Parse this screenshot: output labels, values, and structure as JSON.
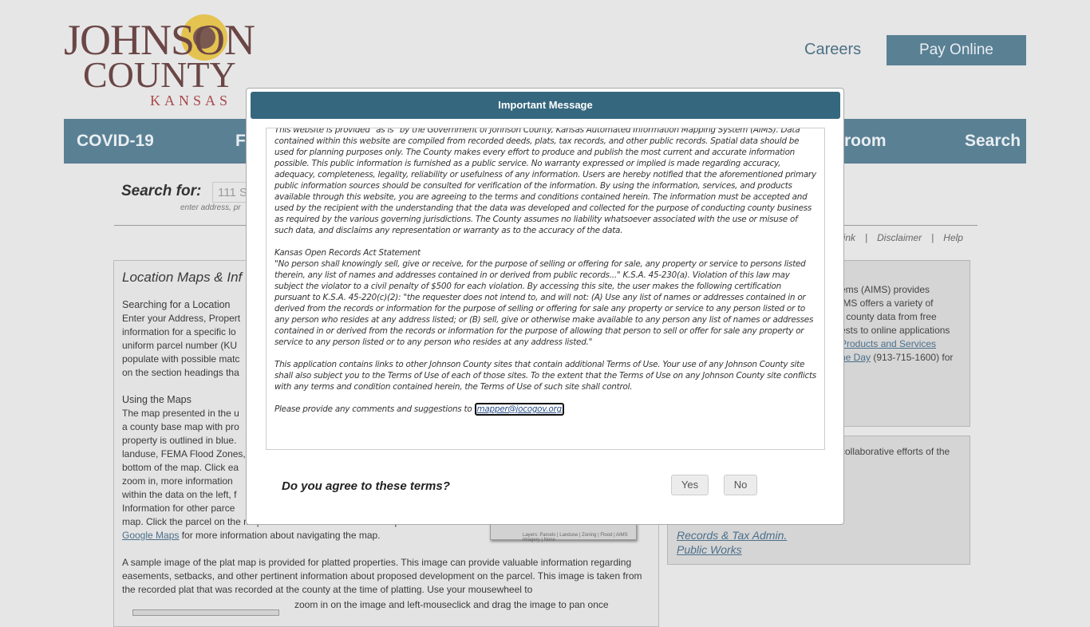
{
  "logo": {
    "line1": "JOHNSON",
    "line2": "COUNTY",
    "line3": "KANSAS"
  },
  "header": {
    "careers": "Careers",
    "pay_online": "Pay Online"
  },
  "nav": [
    "COVID-19",
    "Fo",
    "room",
    "Search"
  ],
  "search": {
    "label": "Search for:",
    "value": "111 S",
    "hint": "enter address, pr"
  },
  "links": [
    "Link",
    "Disclaimer",
    "Help"
  ],
  "main": {
    "title": "Location Maps & Inf",
    "s1_head": "Searching for a Location",
    "s1_lines": [
      "Enter your Address, Propert",
      "information for a specific lo",
      "uniform parcel number (KU",
      "populate with possible matc",
      "on the section headings tha"
    ],
    "s2_head": "Using the Maps",
    "s2_lines": [
      "The map presented in the u",
      "a county base map with pro",
      "property is outlined in blue.",
      "landuse, FEMA Flood Zones,",
      "bottom of the map. Click ea",
      "zoom in, more information",
      "within the data on the left, f",
      "Information for other parce"
    ],
    "s2_tail1": "map. Click the parcel on the map to load the information for that parcel. See",
    "google_maps_link": "Google Maps",
    "s2_tail2": " for more information about navigating the map.",
    "thumb_caption": "Layers: Parcels | Landuse | Zoning | Flood | AIMS Imagery | None",
    "s3": "A sample image of the plat map is provided for platted properties. This image can provide valuable information regarding easements, setbacks, and other pertinent information about proposed development on the parcel. This image is taken from the recorded plat that was recorded at the county at the time of platting. Use your mousewheel to",
    "s3_tail": "zoom in on the image and left-mouseclick and drag the image to pan once"
  },
  "side1": {
    "lines": [
      "ems (AIMS) provides",
      "IMS offers a variety of",
      "r county data from free",
      "ests to online applications"
    ],
    "products_link": "Products and Services",
    "day_link": "he Day",
    "phone": " (913-715-1600) for"
  },
  "side2": {
    "text": "collaborative efforts of the",
    "links": [
      "Records & Tax Admin.",
      "Public Works"
    ]
  },
  "modal": {
    "title": "Important Message",
    "p1": "This website is provided \"as is\" by the Government of Johnson County, Kansas Automated Information Mapping System (AIMS). Data contained within this website are compiled from recorded deeds, plats, tax records, and other public records. Spatial data should be used for planning purposes only. The County makes every effort to produce and publish the most current and accurate information possible. This public information is furnished as a public service. No warranty expressed or implied is made regarding accuracy, adequacy, completeness, legality, reliability or usefulness of any information. Users are hereby notified that the aforementioned primary public information sources should be consulted for verification of the information. By using the information, services, and products available through this website, you are agreeing to the terms and conditions contained herein. The information must be accepted and used by the recipient with the understanding that the data was developed and collected for the purpose of conducting county business as required by the various governing jurisdictions. The County assumes no liability whatsoever associated with the use or misuse of such data, and disclaims any representation or warranty as to the accuracy of the data.",
    "kora_head": "Kansas Open Records Act Statement",
    "p2": "\"No person shall knowingly sell, give or receive, for the purpose of selling or offering for sale, any property or service to persons listed therein, any list of names and addresses contained in or derived from public records...\" K.S.A. 45-230(a). Violation of this law may subject the violator to a civil penalty of $500 for each violation. By accessing this site, the user makes the following certification pursuant to K.S.A. 45-220(c)(2): \"the requester does not intend to, and will not: (A) Use any list of names or addresses contained in or derived from the records or information for the purpose of selling or offering for sale any property or service to any person listed or to any person who resides at any address listed; or (B) sell, give or otherwise make available to any person any list of names or addresses contained in or derived from the records or information for the purpose of allowing that person to sell or offer for sale any property or service to any person listed or to any person who resides at any address listed.\"",
    "p3": "This application contains links to other Johnson County sites that contain additional Terms of Use. Your use of any Johnson County site shall also subject you to the Terms of Use of each of those sites. To the extent that the Terms of Use on any Johnson County site conflicts with any terms and condition contained herein, the Terms of Use of such site shall control.",
    "p4": "Please provide any comments and suggestions to ",
    "email": "mapper@jocogov.org",
    "question": "Do you agree to these terms?",
    "yes": "Yes",
    "no": "No"
  }
}
